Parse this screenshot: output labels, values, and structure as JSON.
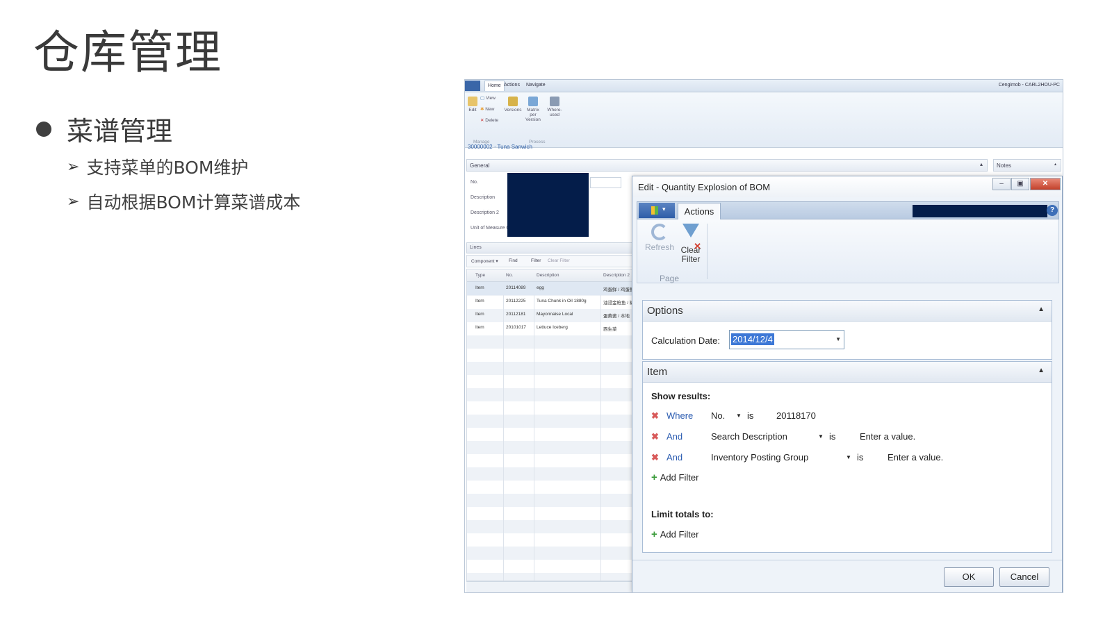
{
  "slide": {
    "title": "仓库管理",
    "bullet": "菜谱管理",
    "sub_items": [
      "支持菜单的BOM维护",
      "自动根据BOM计算菜谱成本"
    ]
  },
  "nav": {
    "tabs": [
      "Home",
      "Actions",
      "Navigate"
    ],
    "user": "Cengimob - CARL2HOU-PC",
    "ribbon_buttons": [
      "Edit",
      "View",
      "New",
      "Delete",
      "Versions",
      "Matrix per Version",
      "Where-used"
    ],
    "ribbon_groups": [
      "Manage",
      "Process"
    ],
    "breadcrumb": "30000002 · Tuna Sanwich",
    "general_label": "General",
    "notes_label": "Notes",
    "fields": [
      "No.",
      "Description",
      "Description 2",
      "Unit of Measure Co"
    ],
    "lines_label": "Lines",
    "lines_tools": [
      "Component ▾",
      "Find",
      "Filter",
      "Clear Filter"
    ],
    "grid": {
      "headers": [
        "Type",
        "No.",
        "Description",
        "Description 2"
      ],
      "rows": [
        [
          "Item",
          "20114089",
          "egg",
          "鸡蛋鲜 / 鸡蛋鲜"
        ],
        [
          "Item",
          "20112225",
          "Tuna Chunk in Oil 1880g",
          "油浸金枪鱼 / 罐装"
        ],
        [
          "Item",
          "20112181",
          "Mayonnaise Local",
          "蛋黄酱 / 本地"
        ],
        [
          "Item",
          "20101017",
          "Lettuce Iceberg",
          "西生菜"
        ]
      ]
    }
  },
  "dialog": {
    "title": "Edit - Quantity Explosion of BOM",
    "tab_actions": "Actions",
    "ribbon": {
      "refresh": "Refresh",
      "clear_filter_1": "Clear",
      "clear_filter_2": "Filter",
      "group": "Page"
    },
    "options": {
      "header": "Options",
      "calc_date_label": "Calculation Date:",
      "calc_date_value": "2014/12/4"
    },
    "item": {
      "header": "Item",
      "show_results": "Show results:",
      "filters": [
        {
          "op": "Where",
          "field": "No.",
          "is": "is",
          "value": "20118170"
        },
        {
          "op": "And",
          "field": "Search Description",
          "is": "is",
          "value": "Enter a value."
        },
        {
          "op": "And",
          "field": "Inventory Posting Group",
          "is": "is",
          "value": "Enter a value."
        }
      ],
      "add_filter": "Add Filter",
      "limit_totals": "Limit totals to:",
      "add_filter_2": "Add Filter"
    },
    "buttons": {
      "ok": "OK",
      "cancel": "Cancel"
    }
  }
}
